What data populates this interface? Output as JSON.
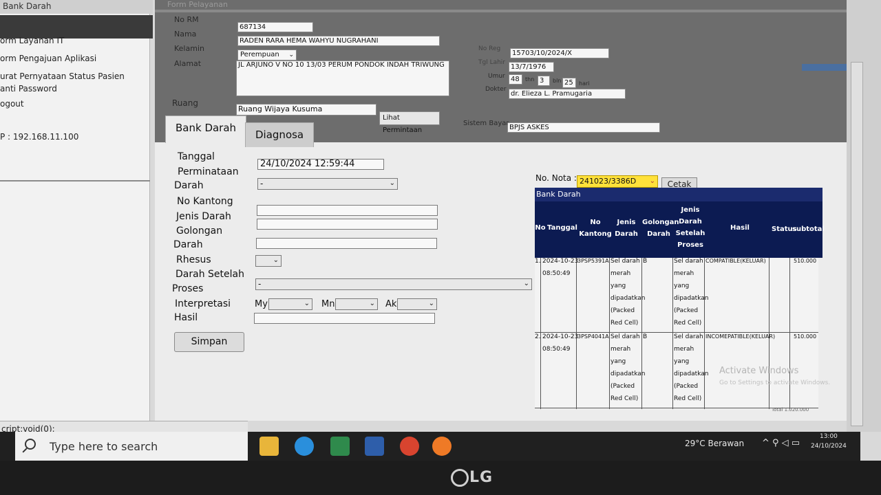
{
  "sidebar": {
    "header": "Bank Darah",
    "items": [
      "orm Layanan IT",
      "orm Pengajuan Aplikasi",
      "urat Pernyataan Status Pasien",
      "anti Password",
      "ogout"
    ],
    "ip": "P : 192.168.11.100"
  },
  "header": {
    "title": "Form Pelayanan",
    "no_rm_label": "No RM",
    "no_rm": "687134",
    "nama_label": "Nama",
    "nama": "RADEN RARA HEMA WAHYU NUGRAHANI",
    "kelamin_label": "Kelamin",
    "kelamin": "Perempuan",
    "alamat_label": "Alamat",
    "alamat": "JL ARJUNO V NO 10 13/03 PERUM PONDOK INDAH TRIWUNG",
    "ruang_label": "Ruang",
    "ruang": "Ruang  Wijaya Kusuma",
    "lihat_permintaan": "Lihat Permintaan",
    "no_reg_label": "No Reg",
    "no_reg": "15703/10/2024/X",
    "tgl_lahir_label": "Tgl Lahir",
    "tgl_lahir": "13/7/1976",
    "umur_label": "Umur",
    "umur_th": "48",
    "th_label": "thn",
    "umur_bln": "3",
    "bln_label": "bln",
    "umur_hari": "25",
    "hari_label": "hari",
    "dokter_label": "Dokter",
    "dokter": "dr. Elieza L. Pramugaria",
    "sistem_bayar_label": "Sistem Bayar",
    "sistem_bayar": "BPJS ASKES"
  },
  "tabs": [
    {
      "label": "Bank Darah",
      "active": true
    },
    {
      "label": "Diagnosa",
      "active": false
    }
  ],
  "form": {
    "tanggal_label": "Tanggal",
    "perminataan_label": "Perminataan",
    "tanggal_value": "24/10/2024 12:59:44",
    "darah_label": "Darah",
    "darah_value": "-",
    "no_kantong_label": "No Kantong",
    "jenis_darah_label": "Jenis Darah",
    "golongan_label": "Golongan",
    "darah2_label": "Darah",
    "rhesus_label": "Rhesus",
    "darah_setelah_label": "Darah Setelah",
    "proses_label": "Proses",
    "proses_value": "-",
    "interpretasi_label": "Interpretasi",
    "hasil_label": "Hasil",
    "my_label": "My",
    "mn_label": "Mn",
    "ak_label": "Ak",
    "simpan": "Simpan"
  },
  "nota": {
    "label": "No. Nota :",
    "value": "241023/3386D",
    "cetak": "Cetak"
  },
  "table": {
    "title": "Bank Darah",
    "columns": [
      "No",
      "Tanggal",
      "No Kantong",
      "Jenis Darah",
      "Golongan Darah",
      "Jenis Darah Setelah Proses",
      "Hasil",
      "Status",
      "subtotal"
    ],
    "rows": [
      {
        "no": "1.",
        "tanggal": "2024-10-23\n08:50:49",
        "kantong": "3PSP5391A",
        "jenis": "Sel darah\nmerah\nyang\ndipadatkan\n(Packed\nRed Cell)",
        "golongan": "B",
        "setelah": "Sel darah\nmerah\nyang\ndipadatkan\n(Packed\nRed Cell)",
        "hasil": "COMPATIBLE(KELUAR)",
        "subtotal": "510.000"
      },
      {
        "no": "2.",
        "tanggal": "2024-10-23\n08:50:49",
        "kantong": "3PSP4041A",
        "jenis": "Sel darah\nmerah\nyang\ndipadatkan\n(Packed\nRed Cell)",
        "golongan": "B",
        "setelah": "Sel darah\nmerah\nyang\ndipadatkan\n(Packed\nRed Cell)",
        "hasil": "INCOMEPATIBLE(KELUAR)",
        "subtotal": "510.000"
      }
    ],
    "total": "Total 1.020.000"
  },
  "watermark": {
    "line1": "Activate Windows",
    "line2": "Go to Settings to activate Windows."
  },
  "statusbar": "cript:void(0);",
  "taskbar": {
    "search_placeholder": "Type here to search",
    "weather": "29°C Berawan",
    "time": "13:00",
    "date": "24/10/2024"
  },
  "monitor_brand": "LG"
}
